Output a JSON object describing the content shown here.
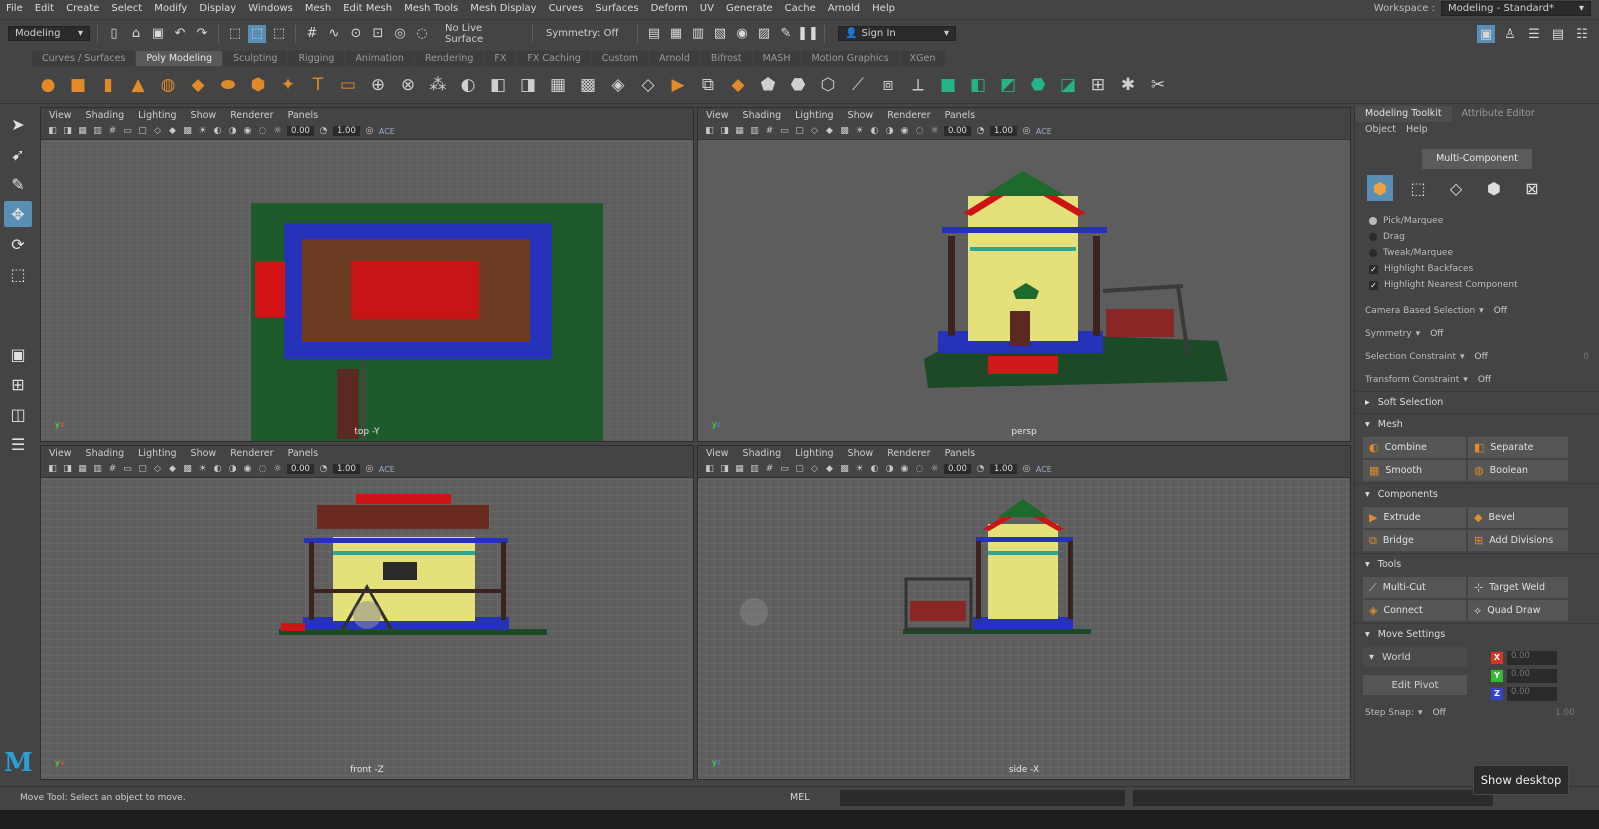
{
  "menubar": [
    "File",
    "Edit",
    "Create",
    "Select",
    "Modify",
    "Display",
    "Windows",
    "Mesh",
    "Edit Mesh",
    "Mesh Tools",
    "Mesh Display",
    "Curves",
    "Surfaces",
    "Deform",
    "UV",
    "Generate",
    "Cache",
    "Arnold",
    "Help"
  ],
  "workspace": {
    "label": "Workspace :",
    "value": "Modeling - Standard*"
  },
  "statusline": {
    "mode": "Modeling",
    "live_surface": "No Live Surface",
    "symmetry": "Symmetry: Off",
    "sign_in": "Sign In"
  },
  "shelf_tabs": [
    "Curves / Surfaces",
    "Poly Modeling",
    "Sculpting",
    "Rigging",
    "Animation",
    "Rendering",
    "FX",
    "FX Caching",
    "Custom",
    "Arnold",
    "Bifrost",
    "MASH",
    "Motion Graphics",
    "XGen"
  ],
  "shelf_active_tab": "Poly Modeling",
  "viewport_menu": [
    "View",
    "Shading",
    "Lighting",
    "Show",
    "Renderer",
    "Panels"
  ],
  "viewport_values": {
    "exposure": "0.00",
    "gamma": "1.00",
    "colorspace": "ACE"
  },
  "viewports": [
    {
      "camera": "top -Y"
    },
    {
      "camera": "persp"
    },
    {
      "camera": "front -Z"
    },
    {
      "camera": "side -X"
    }
  ],
  "panel": {
    "tabs": [
      "Modeling Toolkit",
      "Attribute Editor"
    ],
    "sub": [
      "Object",
      "Help"
    ],
    "multi_component": "Multi-Component",
    "pick_options": [
      "Pick/Marquee",
      "Drag",
      "Tweak/Marquee"
    ],
    "checks": [
      "Highlight Backfaces",
      "Highlight Nearest Component"
    ],
    "props": [
      {
        "label": "Camera Based Selection",
        "value": "Off"
      },
      {
        "label": "Symmetry",
        "value": "Off"
      },
      {
        "label": "Selection Constraint",
        "value": "Off",
        "extra": "0"
      },
      {
        "label": "Transform Constraint",
        "value": "Off"
      }
    ],
    "soft_selection": "Soft Selection",
    "sections": {
      "mesh": {
        "title": "Mesh",
        "buttons": [
          "Combine",
          "Separate",
          "Smooth",
          "Boolean"
        ]
      },
      "components": {
        "title": "Components",
        "buttons": [
          "Extrude",
          "Bevel",
          "Bridge",
          "Add Divisions"
        ]
      },
      "tools": {
        "title": "Tools",
        "buttons": [
          "Multi-Cut",
          "Target Weld",
          "Connect",
          "Quad Draw"
        ]
      }
    },
    "move_settings": {
      "title": "Move Settings",
      "space": "World",
      "edit_pivot": "Edit Pivot",
      "x": "0.00",
      "y": "0.00",
      "z": "0.00",
      "step_snap_label": "Step Snap:",
      "step_snap": "Off",
      "step_value": "1.00"
    }
  },
  "helpline": {
    "text": "Move Tool: Select an object to move.",
    "lang": "MEL"
  },
  "tooltip": "Show desktop",
  "colors": {
    "select_blue": "#5a8fb5",
    "shelf_orange": "#e08a2a",
    "shelf_teal": "#27b389"
  }
}
